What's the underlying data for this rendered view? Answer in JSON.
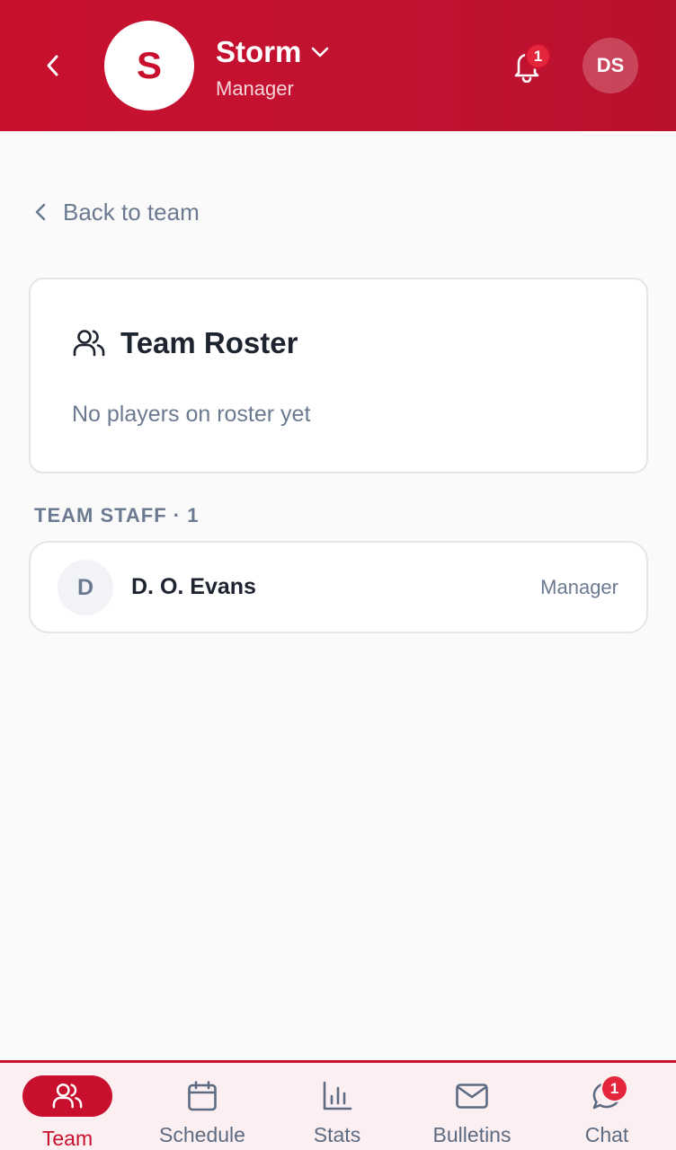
{
  "header": {
    "team_initial": "S",
    "team_name": "Storm",
    "role": "Manager",
    "notification_count": "1",
    "user_initials": "DS"
  },
  "back_link": {
    "label": "Back to team"
  },
  "roster": {
    "title": "Team Roster",
    "empty_text": "No players on roster yet"
  },
  "staff": {
    "heading": "TEAM STAFF · 1",
    "members": [
      {
        "initial": "D",
        "name": "D. O. Evans",
        "role": "Manager"
      }
    ]
  },
  "bottom_nav": {
    "items": [
      {
        "label": "Team",
        "icon": "users-icon",
        "active": true
      },
      {
        "label": "Schedule",
        "icon": "calendar-icon"
      },
      {
        "label": "Stats",
        "icon": "bar-chart-icon"
      },
      {
        "label": "Bulletins",
        "icon": "mail-icon"
      },
      {
        "label": "Chat",
        "icon": "chat-bubble-icon"
      }
    ],
    "chat_badge": "1"
  },
  "colors": {
    "brand": "#c8102e",
    "muted_text": "#6b7a90",
    "badge": "#e3263c"
  }
}
